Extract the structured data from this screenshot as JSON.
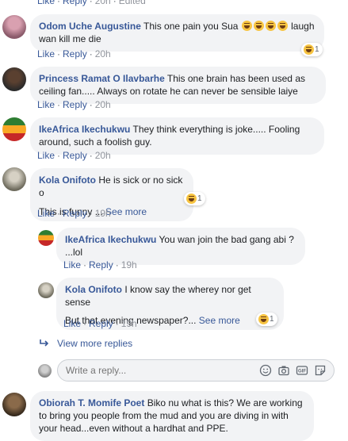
{
  "top_actions": {
    "like": "Like",
    "reply": "Reply",
    "time": "20h",
    "edited": "Edited"
  },
  "comments": [
    {
      "author": "Odom Uche Augustine",
      "text": "This one pain you Sua",
      "text_after": "laugh wan kill me die",
      "like": "Like",
      "reply": "Reply",
      "time": "20h",
      "reaction_count": "1"
    },
    {
      "author": "Princess Ramat O Ilavbarhe",
      "text": "This one brain has been used as ceiling fan..... Always on rotate he can never be sensible laiye",
      "like": "Like",
      "reply": "Reply",
      "time": "20h"
    },
    {
      "author": "IkeAfrica Ikechukwu",
      "text": "They think everything is joke..... Fooling around, such a foolish guy.",
      "like": "Like",
      "reply": "Reply",
      "time": "20h"
    },
    {
      "author": "Kola Onifoto",
      "text": "He is sick or no sick o",
      "text2": "This is funny ...",
      "see_more": "See more",
      "like": "Like",
      "reply": "Reply",
      "time": "19h",
      "reaction_count": "1"
    }
  ],
  "replies": [
    {
      "author": "IkeAfrica Ikechukwu",
      "text": "You wan join the bad gang abi ?",
      "text2": "...lol",
      "like": "Like",
      "reply": "Reply",
      "time": "19h"
    },
    {
      "author": "Kola Onifoto",
      "text": "I know say the wherey nor get sense",
      "text2": "But that evening newspaper?...",
      "see_more": "See more",
      "like": "Like",
      "reply": "Reply",
      "time": "19h",
      "reaction_count": "1"
    }
  ],
  "view_more": "View more replies",
  "composer": {
    "placeholder": "Write a reply...",
    "icons": [
      "emoji-icon",
      "camera-icon",
      "gif-icon",
      "sticker-icon"
    ]
  },
  "last_comment": {
    "author": "Obiorah T. Momife Poet",
    "text": "Biko nu what is this? We are working to bring you people from the mud and you are diving in with your head...even without a hardhat and PPE."
  },
  "colors": {
    "link": "#385898",
    "bubble": "#f2f3f5",
    "meta": "#90949c"
  }
}
